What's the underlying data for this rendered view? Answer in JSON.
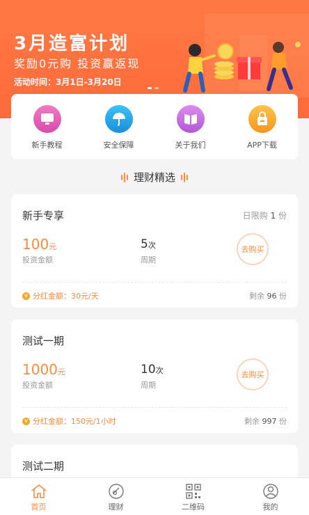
{
  "banner": {
    "title": "3月造富计划",
    "subtitle": "奖励0元购  投资赢返现",
    "time": "活动时间：3月1日-3月20日"
  },
  "quick": [
    {
      "label": "新手教程",
      "icon": "monitor-icon",
      "color": "#e85bb8"
    },
    {
      "label": "安全保障",
      "icon": "umbrella-icon",
      "color": "#2aa7e8"
    },
    {
      "label": "关于我们",
      "icon": "book-icon",
      "color": "#c86ae0"
    },
    {
      "label": "APP下载",
      "icon": "download-icon",
      "color": "#f5a623"
    }
  ],
  "section_title": "理财精选",
  "products": [
    {
      "name": "新手专享",
      "limit_prefix": "日限购",
      "limit_value": "1",
      "limit_unit": "份",
      "amount": "100",
      "amount_unit": "元",
      "amount_label": "投资金额",
      "period": "5",
      "period_unit": "次",
      "period_label": "周期",
      "buy_label": "去购买",
      "dividend": "分红金额：30元/天",
      "remain_prefix": "剩余",
      "remain_value": "96",
      "remain_unit": "份"
    },
    {
      "name": "测试一期",
      "amount": "1000",
      "amount_unit": "元",
      "amount_label": "投资金额",
      "period": "10",
      "period_unit": "次",
      "period_label": "周期",
      "buy_label": "去购买",
      "dividend": "分红金额：150元/1小时",
      "remain_prefix": "剩余",
      "remain_value": "997",
      "remain_unit": "份"
    },
    {
      "name": "测试二期"
    }
  ],
  "nav": [
    {
      "label": "首页",
      "icon": "home-icon",
      "active": true
    },
    {
      "label": "理财",
      "icon": "finance-icon",
      "active": false
    },
    {
      "label": "二维码",
      "icon": "qrcode-icon",
      "active": false
    },
    {
      "label": "我的",
      "icon": "user-icon",
      "active": false
    }
  ],
  "colors": {
    "accent": "#ff8a3d",
    "banner": "#ff6a3a"
  }
}
